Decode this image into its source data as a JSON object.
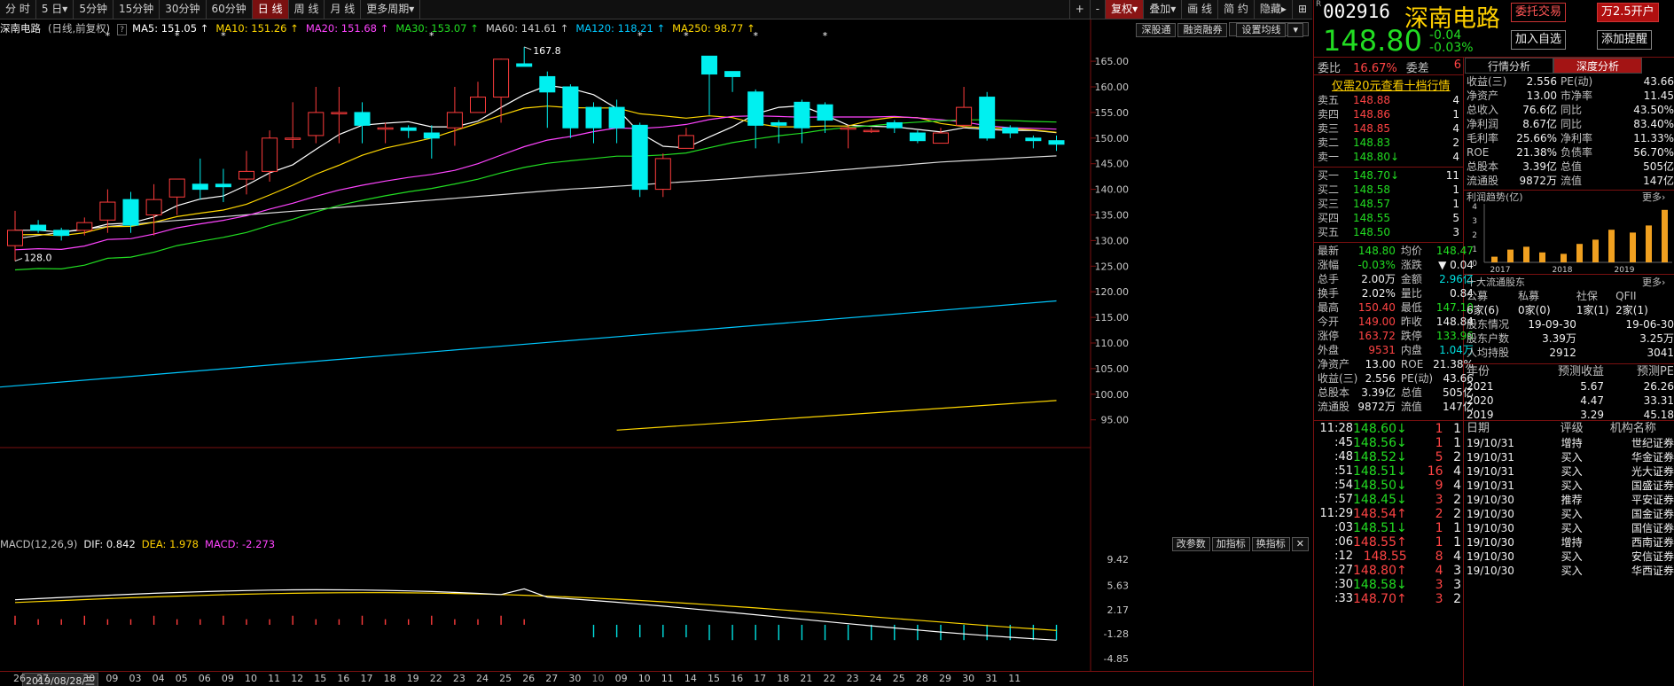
{
  "toolbar": {
    "periods": [
      "分 时",
      "5 日",
      "5分钟",
      "15分钟",
      "30分钟",
      "60分钟",
      "日 线",
      "周 线",
      "月 线",
      "更多周期"
    ],
    "active": "日 线",
    "right": [
      "+",
      "-",
      "复权",
      "叠加",
      "画 线",
      "简 约",
      "隐藏"
    ],
    "icon_names": [
      "zoom-in-icon",
      "zoom-out-icon",
      "chevron-down-icon",
      "chevron-down-icon",
      "pen-icon",
      "layout-icon",
      "hide-icon"
    ]
  },
  "header": {
    "name": "深南电路",
    "mode": "(日线,前复权)",
    "qm": "?",
    "ma": [
      {
        "label": "MA5: 151.05",
        "color": "#ffffff"
      },
      {
        "label": "MA10: 151.26",
        "color": "#ffd700"
      },
      {
        "label": "MA20: 151.68",
        "color": "#ff44ff"
      },
      {
        "label": "MA30: 153.07",
        "color": "#22dd22"
      },
      {
        "label": "MA60: 141.61",
        "color": "#cccccc"
      },
      {
        "label": "MA120: 118.21",
        "color": "#00c8ff"
      },
      {
        "label": "MA250: 98.77",
        "color": "#ffd700"
      }
    ],
    "buttons": [
      "深股通",
      "融资融券",
      "设置均线"
    ]
  },
  "chart_data": {
    "type": "candlestick",
    "yaxis": [
      165,
      160,
      155,
      150,
      145,
      140,
      135,
      130,
      125,
      120,
      115,
      110,
      105,
      100,
      95
    ],
    "x_ticks": [
      "26",
      "27",
      "28",
      "29",
      "30",
      "02",
      "03",
      "04",
      "05",
      "06",
      "09",
      "10",
      "11",
      "12",
      "15",
      "16",
      "17",
      "18",
      "19",
      "22",
      "23",
      "24",
      "25",
      "26",
      "27",
      "30",
      "31",
      "06",
      "07",
      "08",
      "09",
      "10",
      "11",
      "14",
      "15",
      "16",
      "17",
      "18",
      "21",
      "22",
      "23",
      "24",
      "25",
      "28",
      "29",
      "30",
      "31",
      "01",
      "04",
      "05",
      "06",
      "07",
      "08",
      "11"
    ],
    "annotations": [
      {
        "text": "167.8",
        "type": "high"
      },
      {
        "text": "128.0",
        "type": "low"
      }
    ],
    "candles": [
      [
        129,
        132,
        126,
        135.8
      ],
      [
        133,
        132,
        131.5,
        134
      ],
      [
        132,
        131,
        130,
        132.5
      ],
      [
        132,
        133.5,
        131,
        134.5
      ],
      [
        134,
        137.5,
        131.5,
        140
      ],
      [
        138,
        133,
        131.5,
        139.5
      ],
      [
        135,
        138,
        131,
        141
      ],
      [
        138.5,
        142,
        135,
        142
      ],
      [
        141,
        140,
        138,
        146
      ],
      [
        141,
        140.5,
        137.5,
        144
      ],
      [
        142,
        143.5,
        139,
        147.5
      ],
      [
        143.5,
        150,
        141.5,
        151.5
      ],
      [
        150,
        150,
        148,
        157
      ],
      [
        150.5,
        155,
        149,
        160
      ],
      [
        155,
        155,
        149,
        160
      ],
      [
        155,
        152.5,
        149,
        157
      ],
      [
        152,
        152,
        149,
        153
      ],
      [
        152,
        151.5,
        150,
        152.5
      ],
      [
        151,
        150,
        146,
        152.5
      ],
      [
        152,
        155,
        148.5,
        160
      ],
      [
        155,
        158,
        155,
        161
      ],
      [
        158,
        165.4,
        153,
        165.5
      ],
      [
        164.5,
        164,
        164,
        167.8
      ],
      [
        162,
        159,
        152,
        163
      ],
      [
        160,
        152,
        150,
        160.5
      ],
      [
        156,
        152,
        149,
        157
      ],
      [
        156,
        152,
        149,
        157.5
      ],
      [
        152.5,
        140,
        138.5,
        153
      ],
      [
        140,
        146,
        138.5,
        147
      ],
      [
        148,
        150.5,
        148,
        152
      ],
      [
        166,
        162.5,
        154.5,
        166
      ],
      [
        163,
        162,
        159,
        163
      ],
      [
        159,
        152.5,
        148,
        159.5
      ],
      [
        153,
        152.5,
        149,
        153.5
      ],
      [
        157,
        152,
        149,
        157.5
      ],
      [
        156.5,
        153.5,
        151,
        157
      ],
      [
        152,
        152,
        148,
        152.5
      ],
      [
        151.5,
        151.5,
        151,
        152
      ],
      [
        153,
        152,
        151,
        153.5
      ],
      [
        151,
        149.5,
        149,
        151.5
      ],
      [
        149,
        151,
        149,
        152
      ],
      [
        152.5,
        156,
        152,
        160
      ],
      [
        158,
        150,
        149.5,
        159
      ],
      [
        152,
        151,
        150,
        152.5
      ],
      [
        150,
        149.5,
        148,
        150.5
      ],
      [
        149.5,
        148.8,
        147.5,
        150.5
      ]
    ],
    "ma_lines": {
      "MA60": [
        [
          0,
          94
        ],
        [
          1,
          88.5
        ],
        [
          2,
          83
        ],
        [
          3,
          78
        ],
        [
          4,
          74
        ],
        [
          5,
          70.5
        ],
        [
          6,
          67
        ],
        [
          7,
          64
        ],
        [
          8,
          61
        ],
        [
          9,
          58
        ],
        [
          10,
          55
        ],
        [
          11,
          52
        ],
        [
          12,
          49
        ],
        [
          13,
          46
        ],
        [
          14,
          43
        ],
        [
          15,
          40
        ],
        [
          16,
          37
        ],
        [
          17,
          34
        ],
        [
          18,
          31
        ],
        [
          19,
          28
        ],
        [
          20,
          25
        ],
        [
          21,
          22
        ],
        [
          22,
          19
        ],
        [
          23,
          16
        ],
        [
          24,
          13
        ],
        [
          25,
          11
        ],
        [
          26,
          8.5
        ],
        [
          27,
          6
        ],
        [
          28,
          3.5
        ],
        [
          29,
          1
        ],
        [
          30,
          -1.5
        ],
        [
          31,
          -4
        ],
        [
          32,
          -7
        ],
        [
          33,
          -10
        ],
        [
          34,
          -13
        ],
        [
          35,
          -16
        ],
        [
          36,
          -19
        ],
        [
          37,
          -22
        ],
        [
          38,
          -25
        ],
        [
          39,
          -28
        ],
        [
          40,
          -31
        ],
        [
          41,
          -33
        ],
        [
          42,
          -35
        ],
        [
          43,
          -37
        ],
        [
          44,
          -39
        ],
        [
          45,
          -41
        ]
      ],
      "MA120": [
        [
          0,
          69
        ],
        [
          5,
          64
        ],
        [
          10,
          59
        ],
        [
          15,
          54
        ],
        [
          20,
          49
        ],
        [
          25,
          44
        ],
        [
          30,
          39
        ],
        [
          35,
          34
        ],
        [
          40,
          28
        ],
        [
          45,
          21
        ]
      ],
      "MA250": [
        [
          25,
          -86
        ],
        [
          30,
          -81
        ],
        [
          35,
          -76
        ],
        [
          40,
          -71
        ],
        [
          45,
          -66
        ]
      ]
    }
  },
  "macd": {
    "label": "MACD(12,26,9)",
    "dif": "DIF: 0.842",
    "dea": "DEA: 1.978",
    "macd": "MACD: -2.273",
    "yaxis": [
      "9.42",
      "5.63",
      "2.17",
      "-1.28",
      "-4.85"
    ],
    "buttons": [
      "改参数",
      "加指标",
      "换指标"
    ]
  },
  "xaxis": {
    "date_label": "2019/08/28/三",
    "ticks": [
      "26",
      "27",
      "",
      "30",
      "09",
      "03",
      "04",
      "05",
      "06",
      "09",
      "10",
      "11",
      "12",
      "15",
      "16",
      "17",
      "18",
      "19",
      "22",
      "23",
      "24",
      "25",
      "26",
      "27",
      "30",
      "10",
      "09",
      "10",
      "11",
      "14",
      "15",
      "16",
      "17",
      "18",
      "21",
      "22",
      "23",
      "24",
      "25",
      "28",
      "29",
      "30",
      "31",
      "11"
    ]
  },
  "panel": {
    "code": "002916",
    "r": "R",
    "name": "深南电路",
    "btn1": "委托交易",
    "btn2": "万2.5开户",
    "price": "148.80",
    "chg": "-0.04",
    "pct": "-0.03%",
    "btn3": "加入自选",
    "btn4": "添加提醒",
    "wb_label": "委比",
    "wb": "16.67%",
    "wc_label": "委差",
    "wc": "6",
    "tabs": [
      "行情分析",
      "深度分析"
    ],
    "promo": "仅需20元查看十档行情",
    "sells": [
      [
        "卖五",
        "148.88",
        "4"
      ],
      [
        "卖四",
        "148.86",
        "1"
      ],
      [
        "卖三",
        "148.85",
        "4"
      ],
      [
        "卖二",
        "148.83",
        "2"
      ],
      [
        "卖一",
        "148.80↓",
        "4"
      ]
    ],
    "buys": [
      [
        "买一",
        "148.70↓",
        "11"
      ],
      [
        "买二",
        "148.58",
        "1"
      ],
      [
        "买三",
        "148.57",
        "1"
      ],
      [
        "买四",
        "148.55",
        "5"
      ],
      [
        "买五",
        "148.50",
        "3"
      ]
    ],
    "stats": [
      [
        "最新",
        "148.80",
        "均价",
        "148.47"
      ],
      [
        "涨幅",
        "-0.03%",
        "涨跌",
        "▼ 0.04"
      ],
      [
        "总手",
        "2.00万",
        "金额",
        "2.96亿"
      ],
      [
        "换手",
        "2.02%",
        "量比",
        "0.84"
      ],
      [
        "最高",
        "150.40",
        "最低",
        "147.10"
      ],
      [
        "今开",
        "149.00",
        "昨收",
        "148.84"
      ],
      [
        "涨停",
        "163.72",
        "跌停",
        "133.96"
      ],
      [
        "外盘",
        "9531",
        "内盘",
        "1.04万"
      ],
      [
        "净资产",
        "13.00",
        "ROE",
        "21.38%"
      ],
      [
        "收益(三)",
        "2.556",
        "PE(动)",
        "43.66"
      ],
      [
        "总股本",
        "3.39亿",
        "总值",
        "505亿"
      ],
      [
        "流通股",
        "9872万",
        "流值",
        "147亿"
      ]
    ],
    "ticks": [
      [
        "11:28",
        "148.60↓",
        "1",
        "1"
      ],
      [
        ":45",
        "148.56↓",
        "1",
        "1"
      ],
      [
        ":48",
        "148.52↓",
        "5",
        "2"
      ],
      [
        ":51",
        "148.51↓",
        "16",
        "4"
      ],
      [
        ":54",
        "148.50↓",
        "9",
        "4"
      ],
      [
        ":57",
        "148.45↓",
        "3",
        "2"
      ],
      [
        "11:29",
        "148.54↑",
        "2",
        "2"
      ],
      [
        ":03",
        "148.51↓",
        "1",
        "1"
      ],
      [
        ":06",
        "148.55↑",
        "1",
        "1"
      ],
      [
        ":12",
        "148.55",
        "8",
        "4"
      ],
      [
        ":27",
        "148.80↑",
        "4",
        "3"
      ],
      [
        ":30",
        "148.58↓",
        "3",
        "3"
      ],
      [
        ":33",
        "148.70↑",
        "3",
        "2"
      ]
    ],
    "fund": [
      [
        "收益(三)",
        "2.556",
        "PE(动)",
        "43.66"
      ],
      [
        "净资产",
        "13.00",
        "市净率",
        "11.45"
      ],
      [
        "总收入",
        "76.6亿",
        "同比",
        "43.50%"
      ],
      [
        "净利润",
        "8.67亿",
        "同比",
        "83.40%"
      ],
      [
        "毛利率",
        "25.66%",
        "净利率",
        "11.33%"
      ],
      [
        "ROE",
        "21.38%",
        "负债率",
        "56.70%"
      ],
      [
        "总股本",
        "3.39亿",
        "总值",
        "505亿"
      ],
      [
        "流通股",
        "9872万",
        "流值",
        "147亿"
      ]
    ],
    "trend": {
      "title": "利润趋势(亿)",
      "more": "更多",
      "years": [
        "2017",
        "2018",
        "2019"
      ],
      "yticks": [
        "4",
        "3",
        "2",
        "1",
        "0"
      ],
      "bars": [
        0.4,
        0.9,
        1.1,
        0.7,
        0.6,
        1.3,
        1.6,
        2.3,
        2.1,
        2.6,
        3.7
      ]
    },
    "holders": {
      "title": "十大流通股东",
      "more": "更多",
      "cols": [
        "公募",
        "私募",
        "社保",
        "QFII"
      ],
      "vals": [
        "6家(6)",
        "0家(0)",
        "1家(1)",
        "2家(1)"
      ],
      "rows": [
        [
          "股东情况",
          "19-09-30",
          "19-06-30"
        ],
        [
          "股东户数",
          "3.39万",
          "3.25万"
        ],
        [
          "人均持股",
          "2912",
          "3041"
        ]
      ]
    },
    "forecast": {
      "cols": [
        "年份",
        "预测收益",
        "预测PE"
      ],
      "rows": [
        [
          "2021",
          "5.67",
          "26.26"
        ],
        [
          "2020",
          "4.47",
          "33.31"
        ],
        [
          "2019",
          "3.29",
          "45.18"
        ]
      ]
    },
    "ratings": {
      "cols": [
        "日期",
        "评级",
        "机构名称"
      ],
      "rows": [
        [
          "19/10/31",
          "增持",
          "世纪证券"
        ],
        [
          "19/10/31",
          "买入",
          "华金证券"
        ],
        [
          "19/10/31",
          "买入",
          "光大证券"
        ],
        [
          "19/10/31",
          "买入",
          "国盛证券"
        ],
        [
          "19/10/30",
          "推荐",
          "平安证券"
        ],
        [
          "19/10/30",
          "买入",
          "国金证券"
        ],
        [
          "19/10/30",
          "买入",
          "国信证券"
        ],
        [
          "19/10/30",
          "增持",
          "西南证券"
        ],
        [
          "19/10/30",
          "买入",
          "安信证券"
        ],
        [
          "19/10/30",
          "买入",
          "华西证券"
        ]
      ]
    }
  }
}
